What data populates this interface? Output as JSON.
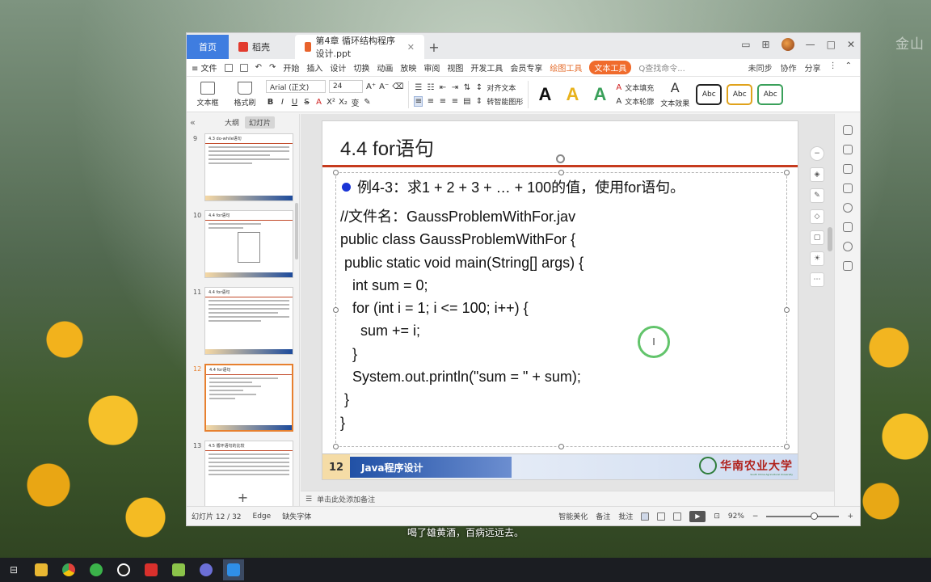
{
  "desktop": {
    "watermark": "金山",
    "video_subtitle": "喝了雄黄酒，百病远远去。"
  },
  "tabs": [
    {
      "label": "首页"
    },
    {
      "label": "稻壳"
    },
    {
      "label": "第4章 循环结构程序设计.ppt"
    }
  ],
  "menu": {
    "file": "≡ 文件",
    "items": [
      "开始",
      "插入",
      "设计",
      "切换",
      "动画",
      "放映",
      "审阅",
      "视图",
      "开发工具",
      "会员专享"
    ],
    "drawing_tools": "绘图工具",
    "text_tools": "文本工具",
    "search": "Q查找命令...",
    "sync": "未同步",
    "collab": "协作",
    "share": "分享"
  },
  "ribbon": {
    "textbox": "文本框",
    "format_painter": "格式刷",
    "font_name": "Arial (正文)",
    "font_size": "24",
    "align_text": "对齐文本",
    "convert_smartart": "转智能图形",
    "text_fill": "文本填充",
    "text_outline": "文本轮廓",
    "text_effect": "文本效果",
    "style_sample": "Abc"
  },
  "left_pane": {
    "outline_tab": "大纲",
    "slides_tab": "幻灯片",
    "thumbnails": [
      {
        "num": "9",
        "title": "4.3 do-while语句"
      },
      {
        "num": "10",
        "title": "4.4 for语句"
      },
      {
        "num": "11",
        "title": "4.4 for语句"
      },
      {
        "num": "12",
        "title": "4.4 for语句"
      },
      {
        "num": "13",
        "title": "4.5 循环语句的比较"
      }
    ]
  },
  "slide": {
    "title": "4.4 for语句",
    "bullet": "例4-3：求1 + 2 + 3 + … + 100的值，使用for语句。",
    "code_lines": [
      "//文件名：GaussProblemWithFor.jav",
      "public class GaussProblemWithFor {",
      " public static void main(String[] args) {",
      "   int sum = 0;",
      "   for (int i = 1; i <= 100; i++) {",
      "     sum += i;",
      "   }",
      "   System.out.println(\"sum = \" + sum);",
      " }",
      "}"
    ],
    "page_number": "12",
    "course_name": "Java程序设计",
    "university": "华南农业大学",
    "university_en": "South China Agricultural University"
  },
  "notes_placeholder": "单击此处添加备注",
  "status": {
    "slide_count": "幻灯片 12 / 32",
    "theme": "Edge",
    "missing_font": "缺失字体",
    "smart_beautify": "智能美化",
    "notes": "备注",
    "comments": "批注",
    "zoom": "92%"
  },
  "colors": {
    "accent_red": "#c63b1e",
    "text_tools": "#f06b2c",
    "course_bar": "#2151a6",
    "bullet": "#1a35d6"
  }
}
